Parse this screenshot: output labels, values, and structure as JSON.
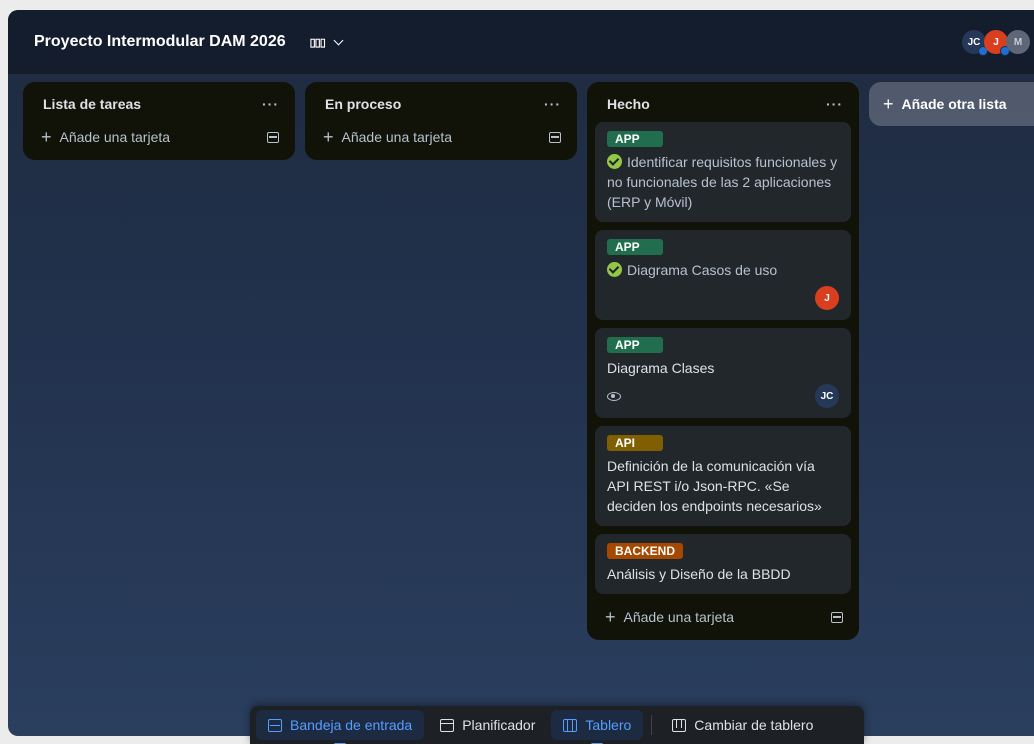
{
  "header": {
    "board_title": "Proyecto Intermodular DAM 2026",
    "view_switch_icon": "board-view-icon"
  },
  "members": [
    {
      "initials": "JC",
      "color": "#253858"
    },
    {
      "initials": "J",
      "color": "#d93f1f"
    },
    {
      "initials": "M",
      "color": "#5e6778"
    }
  ],
  "lists": [
    {
      "title": "Lista de tareas",
      "menu": "···",
      "add_card_label": "Añade una tarjeta"
    },
    {
      "title": "En proceso",
      "menu": "···",
      "add_card_label": "Añade una tarjeta"
    },
    {
      "title": "Hecho",
      "menu": "···",
      "add_card_label": "Añade una tarjeta",
      "cards": [
        {
          "label": "APP",
          "label_color": "#216e4e",
          "completed": true,
          "title": "Identificar requisitos funcionales y no funcionales de las 2 aplicaciones (ERP y Móvil)"
        },
        {
          "label": "APP",
          "label_color": "#216e4e",
          "completed": true,
          "title": "Diagrama Casos de uso",
          "member": "J"
        },
        {
          "label": "APP",
          "label_color": "#216e4e",
          "completed": false,
          "title": "Diagrama Clases",
          "watching": true,
          "member": "JC"
        },
        {
          "label": "API",
          "label_color": "#7f5f01",
          "completed": false,
          "title": "Definición de la comunicación vía API REST i/o Json-RPC. «Se deciden los endpoints necesarios»"
        },
        {
          "label": "BACKEND",
          "label_color": "#a54800",
          "completed": false,
          "title": "Análisis y Diseño de la BBDD"
        }
      ]
    }
  ],
  "add_list_label": "Añade otra lista",
  "bottom_nav": {
    "inbox": "Bandeja de entrada",
    "planner": "Planificador",
    "board": "Tablero",
    "switch_board": "Cambiar de tablero"
  },
  "colors": {
    "accent": "#579dff",
    "card_bg": "#22272b",
    "list_bg": "#111208"
  }
}
